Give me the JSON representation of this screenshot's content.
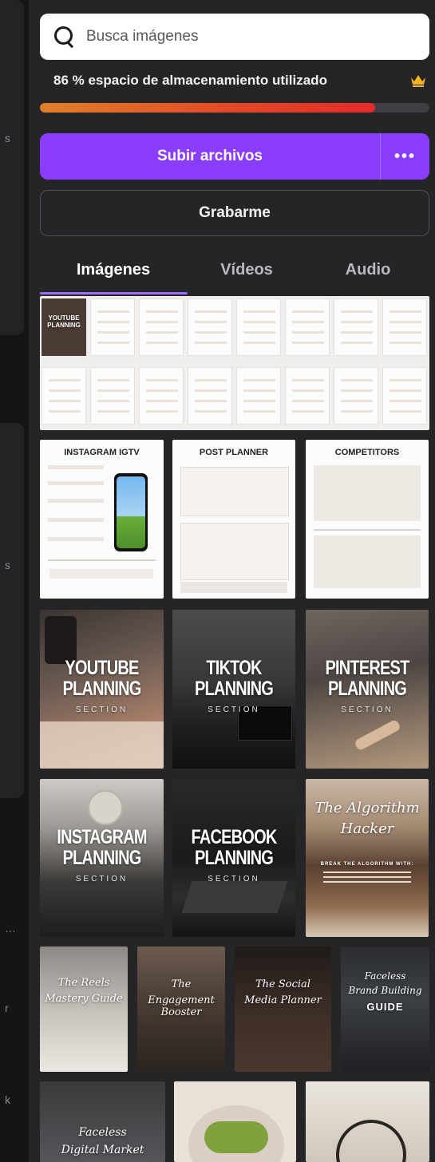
{
  "search": {
    "placeholder": "Busca imágenes"
  },
  "storage": {
    "label": "86 % espacio de almacenamiento utilizado",
    "percent": 86,
    "icon": "crown-icon"
  },
  "buttons": {
    "upload_label": "Subir archivos",
    "more_label": "•••",
    "record_label": "Grabarme"
  },
  "tabs": [
    {
      "label": "Imágenes",
      "active": true
    },
    {
      "label": "Vídeos",
      "active": false
    },
    {
      "label": "Audio",
      "active": false
    }
  ],
  "colors": {
    "accent": "#8b3dff",
    "panel": "#252528",
    "progress_fill": "#e14b26",
    "tab_underline": "#9b6bff"
  },
  "thumbnails": {
    "collage": {
      "cover_line1": "YOUTUBE",
      "cover_line2": "PLANNING"
    },
    "docs": [
      {
        "title": "INSTAGRAM IGTV"
      },
      {
        "title": "POST PLANNER"
      },
      {
        "title": "COMPETITORS"
      }
    ],
    "sections_row1": [
      {
        "line1": "YOUTUBE",
        "line2": "PLANNING",
        "sub": "SECTION"
      },
      {
        "line1": "TIKTOK",
        "line2": "PLANNING",
        "sub": "SECTION"
      },
      {
        "line1": "PINTEREST",
        "line2": "PLANNING",
        "sub": "SECTION"
      }
    ],
    "sections_row2": [
      {
        "line1": "INSTAGRAM",
        "line2": "PLANNING",
        "sub": "SECTION"
      },
      {
        "line1": "FACEBOOK",
        "line2": "PLANNING",
        "sub": "SECTION"
      }
    ],
    "algorithm": {
      "script1": "The Algorithm",
      "script2": "Hacker",
      "caption": "BREAK THE ALGORITHM WITH:"
    },
    "row5": [
      {
        "script1": "The Reels",
        "script2": "Mastery Guide"
      },
      {
        "script1": "The",
        "script2": "Engagement Booster"
      },
      {
        "script1": "The Social",
        "script2": "Media Planner"
      },
      {
        "script1": "Faceless",
        "script2": "Brand Building",
        "bold": "GUIDE"
      }
    ],
    "row6": [
      {
        "script1": "Faceless",
        "script2": "Digital Market"
      }
    ]
  }
}
